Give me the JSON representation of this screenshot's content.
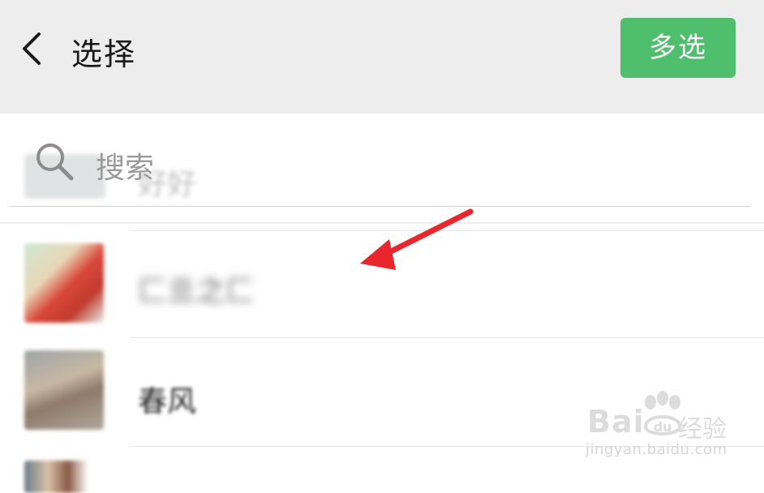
{
  "header": {
    "back_icon": "chevron-left-icon",
    "title": "选择",
    "multi_select_label": "多选",
    "accent_color": "#4fbf6e"
  },
  "search": {
    "icon": "search-icon",
    "placeholder": "搜索",
    "ghost_name": "好好"
  },
  "contacts": [
    {
      "name": "匚亖之匚",
      "avatar": "avatar-photo"
    },
    {
      "name": "春风",
      "avatar": "avatar-photo"
    },
    {
      "name": "",
      "avatar": "avatar-photo"
    }
  ],
  "annotation": {
    "arrow_color": "#e8262c"
  },
  "watermark": {
    "brand": "Bai",
    "suffix": "经验",
    "url": "jingyan.baidu.com"
  }
}
